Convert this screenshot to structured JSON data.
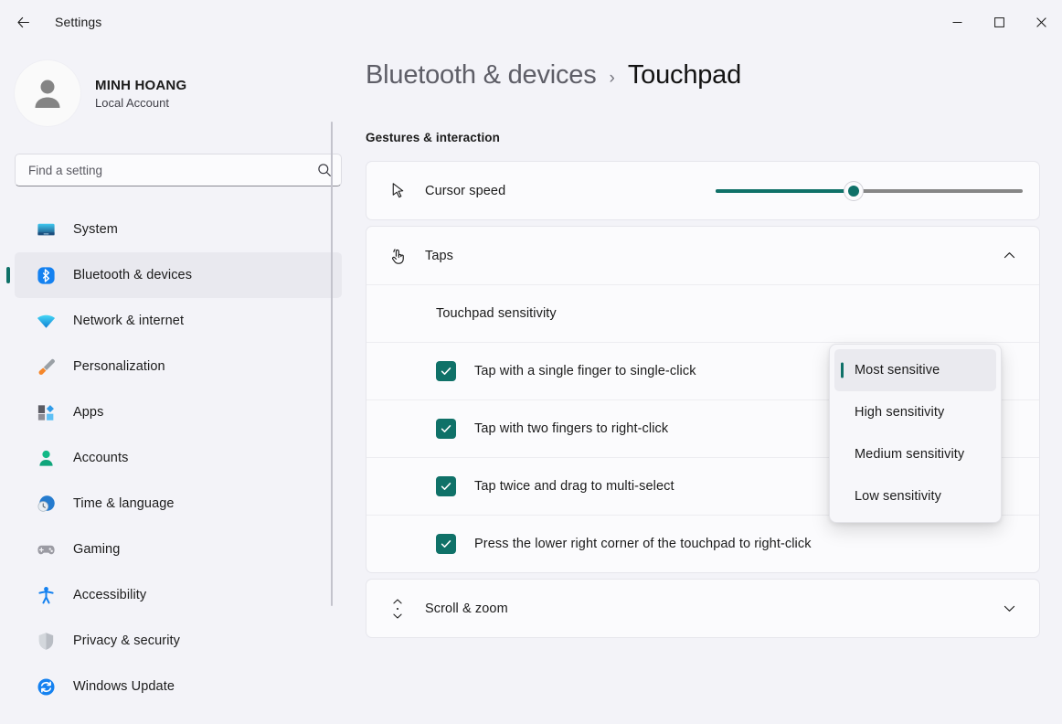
{
  "titlebar": {
    "back_icon": "back-arrow-icon",
    "app_title": "Settings",
    "minimize_label": "—",
    "maximize_label": "□",
    "close_label": "✕"
  },
  "sidebar": {
    "profile": {
      "name": "MINH HOANG",
      "account_type": "Local Account",
      "avatar_icon": "person-avatar-icon"
    },
    "search": {
      "placeholder": "Find a setting",
      "value": "",
      "icon": "search-icon"
    },
    "items": [
      {
        "label": "System",
        "icon": "system-monitor-icon",
        "active": false
      },
      {
        "label": "Bluetooth & devices",
        "icon": "bluetooth-icon",
        "active": true
      },
      {
        "label": "Network & internet",
        "icon": "wifi-icon",
        "active": false
      },
      {
        "label": "Personalization",
        "icon": "paintbrush-icon",
        "active": false
      },
      {
        "label": "Apps",
        "icon": "apps-icon",
        "active": false
      },
      {
        "label": "Accounts",
        "icon": "accounts-person-icon",
        "active": false
      },
      {
        "label": "Time & language",
        "icon": "clock-globe-icon",
        "active": false
      },
      {
        "label": "Gaming",
        "icon": "gamepad-icon",
        "active": false
      },
      {
        "label": "Accessibility",
        "icon": "accessibility-person-icon",
        "active": false
      },
      {
        "label": "Privacy & security",
        "icon": "shield-icon",
        "active": false
      },
      {
        "label": "Windows Update",
        "icon": "update-refresh-icon",
        "active": false
      }
    ]
  },
  "main": {
    "breadcrumb": {
      "parent": "Bluetooth & devices",
      "separator": "›",
      "current": "Touchpad"
    },
    "section_label": "Gestures & interaction",
    "cursor_speed": {
      "label": "Cursor speed",
      "icon": "cursor-arrow-icon",
      "slider_percent": 45
    },
    "taps": {
      "label": "Taps",
      "icon": "tap-gesture-icon",
      "expanded": true,
      "chevron_icon": "chevron-up-icon",
      "sensitivity_label": "Touchpad sensitivity",
      "sensitivity_value": "Most sensitive",
      "options": [
        {
          "label": "Most sensitive",
          "selected": true
        },
        {
          "label": "High sensitivity",
          "selected": false
        },
        {
          "label": "Medium sensitivity",
          "selected": false
        },
        {
          "label": "Low sensitivity",
          "selected": false
        }
      ],
      "checkboxes": [
        {
          "label": "Tap with a single finger to single-click",
          "checked": true
        },
        {
          "label": "Tap with two fingers to right-click",
          "checked": true
        },
        {
          "label": "Tap twice and drag to multi-select",
          "checked": true
        },
        {
          "label": "Press the lower right corner of the touchpad to right-click",
          "checked": true
        }
      ]
    },
    "scroll_zoom": {
      "label": "Scroll & zoom",
      "icon": "scroll-updown-icon",
      "expanded": false,
      "chevron_icon": "chevron-down-icon"
    }
  },
  "colors": {
    "accent": "#0F7168",
    "page_bg": "#F3F3F8",
    "card_bg": "#FBFBFD"
  }
}
